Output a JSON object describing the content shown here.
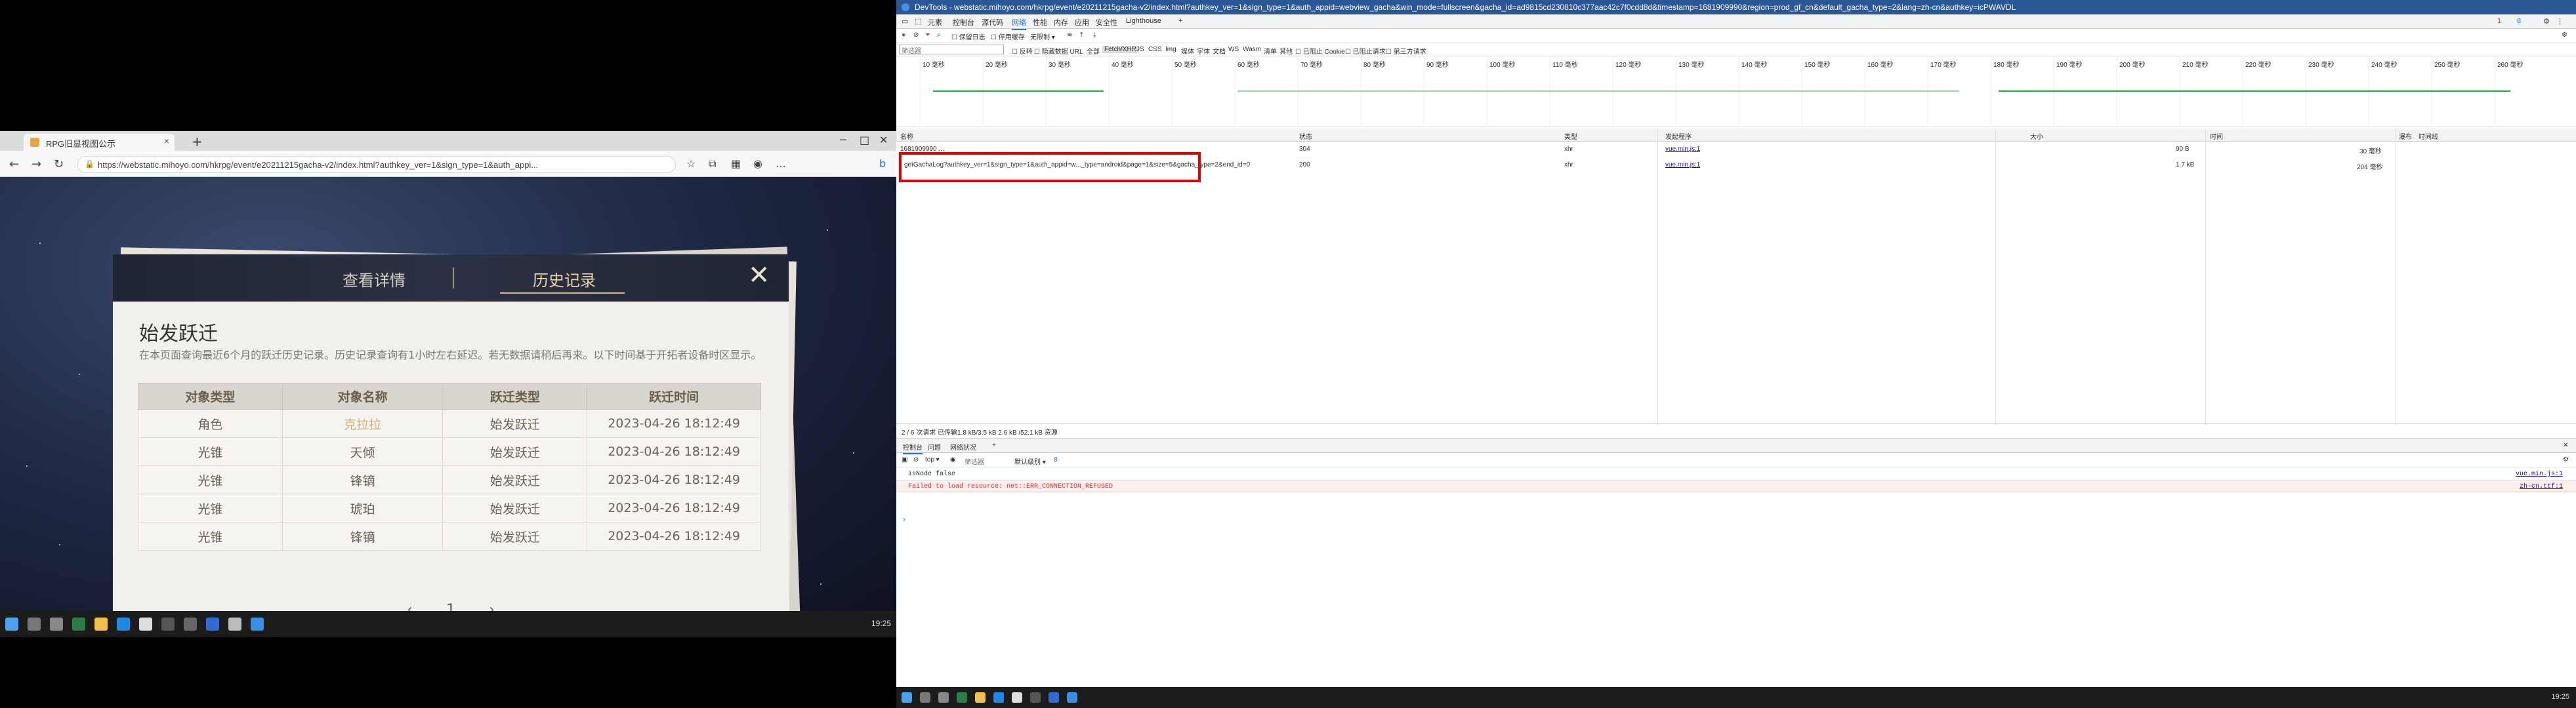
{
  "left_browser": {
    "tab_title": "RPG旧显视图公示",
    "url": "https://webstatic.mihoyo.com/hkrpg/event/e20211215gacha-v2/index.html?authkey_ver=1&sign_type=1&auth_appi..."
  },
  "panel": {
    "tabs": [
      "查看详情",
      "历史记录"
    ],
    "title": "始发跃迁",
    "note": "在本页面查询最近6个月的跃迁历史记录。历史记录查询有1小时左右延迟。若无数据请稍后再来。以下时间基于开拓者设备时区显示。",
    "columns": [
      "对象类型",
      "对象名称",
      "跃迁类型",
      "跃迁时间"
    ],
    "rows": [
      [
        "角色",
        "克拉拉",
        "始发跃迁",
        "2023-04-26 18:12:49"
      ],
      [
        "光锥",
        "天倾",
        "始发跃迁",
        "2023-04-26 18:12:49"
      ],
      [
        "光锥",
        "锋镝",
        "始发跃迁",
        "2023-04-26 18:12:49"
      ],
      [
        "光锥",
        "琥珀",
        "始发跃迁",
        "2023-04-26 18:12:49"
      ],
      [
        "光锥",
        "锋镝",
        "始发跃迁",
        "2023-04-26 18:12:49"
      ]
    ],
    "pager": {
      "prev": "‹",
      "page": "1",
      "next": "›"
    }
  },
  "left_taskbar": {
    "time": "19:25"
  },
  "devtools": {
    "title": "DevTools - webstatic.mihoyo.com/hkrpg/event/e20211215gacha-v2/index.html?authkey_ver=1&sign_type=1&auth_appid=webview_gacha&win_mode=fullscreen&gacha_id=ad9815cd230810c377aac42c7f0cdd8d&timestamp=1681909990&region=prod_gf_cn&default_gacha_type=2&lang=zh-cn&authkey=icPWAVDL",
    "tabs": [
      "元素",
      "控制台",
      "源代码",
      "网络",
      "性能",
      "内存",
      "应用",
      "安全性",
      "Lighthouse"
    ],
    "active_tab": "网络",
    "badges": {
      "errors": "1",
      "warnings": "8"
    },
    "filter_placeholder": "筛选器",
    "toolbar_items": [
      "保留日志",
      "停用缓存",
      "无限制"
    ],
    "filter_types": [
      "反转",
      "隐藏数据 URL",
      "全部",
      "Fetch/XHR",
      "JS",
      "CSS",
      "Img",
      "媒体",
      "字体",
      "文档",
      "WS",
      "Wasm",
      "清单",
      "其他",
      "已阻止 Cookie",
      "已阻止请求",
      "第三方请求"
    ],
    "timeline_ticks": [
      "10 毫秒",
      "20 毫秒",
      "30 毫秒",
      "40 毫秒",
      "50 毫秒",
      "60 毫秒",
      "70 毫秒",
      "80 毫秒",
      "90 毫秒",
      "100 毫秒",
      "110 毫秒",
      "120 毫秒",
      "130 毫秒",
      "140 毫秒",
      "150 毫秒",
      "160 毫秒",
      "170 毫秒",
      "180 毫秒",
      "190 毫秒",
      "200 毫秒",
      "210 毫秒",
      "220 毫秒",
      "230 毫秒",
      "240 毫秒",
      "250 毫秒",
      "260 毫秒"
    ],
    "columns": [
      "名称",
      "状态",
      "类型",
      "发起程序",
      "大小",
      "时间",
      "瀑布",
      "时间线"
    ],
    "requests": [
      {
        "name": "1681909990 ...",
        "status": "304",
        "type": "xhr",
        "initiator": "vue.min.js:1",
        "size": "90 B",
        "time": "30 毫秒"
      },
      {
        "name": "getGachaLog?authkey_ver=1&sign_type=1&auth_appid=w..._type=android&page=1&size=5&gacha_type=2&end_id=0",
        "status": "200",
        "type": "xhr",
        "initiator": "vue.min.js:1",
        "size": "1.7 kB",
        "time": "204 毫秒"
      }
    ],
    "status_line": "2 / 6 次请求  已传输1.8 kB/3.5 kB  2.6 kB /52.1 kB 资源",
    "drawer_tabs": [
      "控制台",
      "问题",
      "网络状况"
    ],
    "console_toolbar": {
      "context": "top",
      "filter_placeholder": "筛选器",
      "level": "默认级别",
      "issues": "8"
    },
    "logs": [
      {
        "text": "isNode false",
        "src": "vue.min.js:1",
        "level": "info"
      },
      {
        "text": "Failed to load resource: net::ERR_CONNECTION_REFUSED",
        "src": "zh-cn.ttf:1",
        "level": "error"
      }
    ],
    "prompt": "›"
  },
  "right_taskbar": {
    "time": "19:25"
  },
  "colors": {
    "accent": "#1a73e8",
    "error": "#d93025",
    "highlight": "#e00000",
    "panel_gold": "#d3bb82"
  }
}
